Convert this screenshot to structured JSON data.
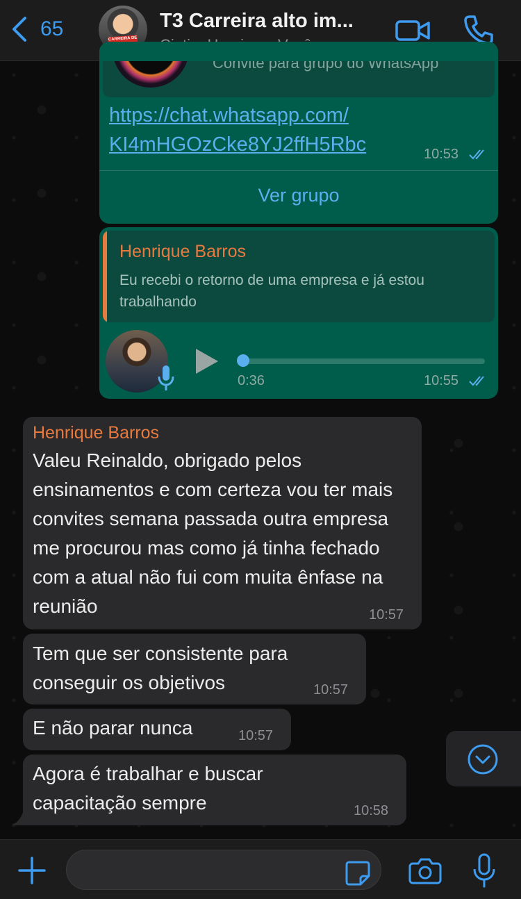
{
  "header": {
    "back_count": "65",
    "title": "T3 Carreira alto im...",
    "subtitle": "Cintia, Henrique, Você",
    "avatar_badge": "CARREIRA DE ALTO IMPACTO"
  },
  "messages": {
    "invite": {
      "card_text": "Convite para grupo do WhatsApp",
      "link_line1": "https://chat.whatsapp.com/",
      "link_line2": "KI4mHGOzCke8YJ2ffH5Rbc",
      "time": "10:53",
      "action": "Ver grupo"
    },
    "voice": {
      "quote_author": "Henrique Barros",
      "quote_text": "Eu recebi o retorno de uma empresa e já estou trabalhando",
      "duration": "0:36",
      "time": "10:55",
      "progress": 0
    },
    "in1": {
      "sender": "Henrique Barros",
      "text": "Valeu Reinaldo, obrigado pelos ensinamentos e com certeza vou ter mais convites semana passada outra empresa me procurou mas como já tinha fechado com a atual não fui com muita ênfase na reunião",
      "time": "10:57"
    },
    "in2": {
      "text": "Tem que ser consistente para conseguir os objetivos",
      "time": "10:57"
    },
    "in3": {
      "text": "E não parar nunca",
      "time": "10:57"
    },
    "in4": {
      "text": "Agora é trabalhar e buscar capacitação sempre",
      "time": "10:58"
    }
  },
  "composer": {
    "value": ""
  },
  "colors": {
    "accent": "#3e9cf0",
    "outgoing_bubble": "#005c4b",
    "incoming_bubble": "#2a2a2c",
    "sender_name": "#e87a3e",
    "read_ticks": "#5ab0ee"
  }
}
